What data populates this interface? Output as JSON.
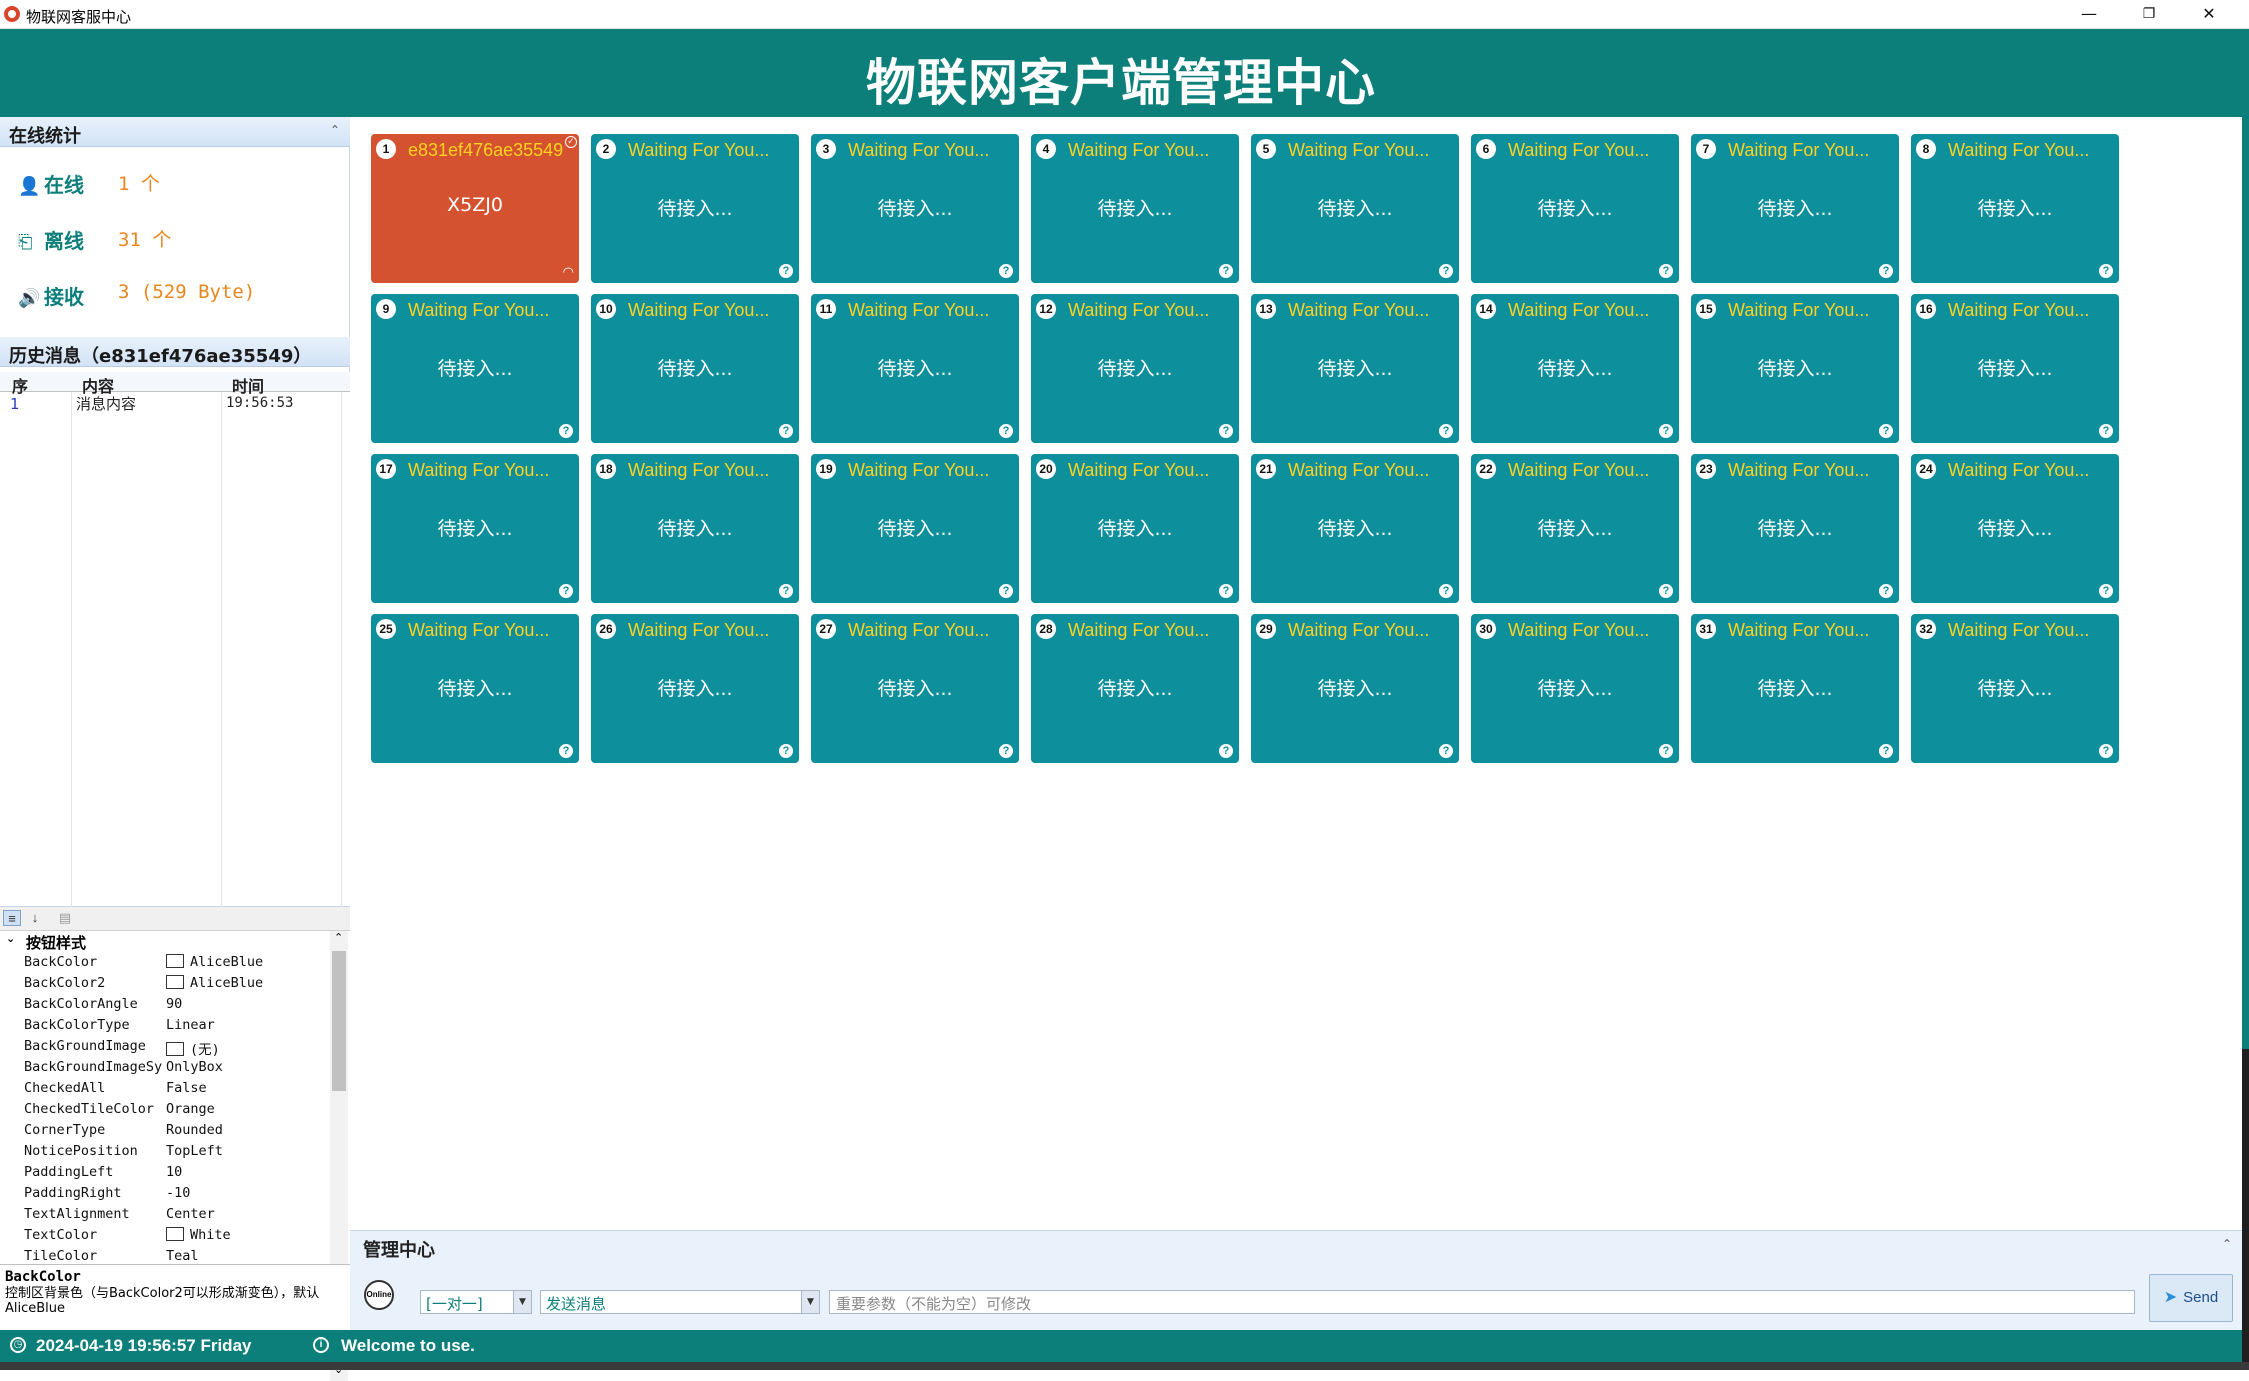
{
  "window": {
    "title": "物联网客服中心",
    "min": "—",
    "max": "❐",
    "close": "✕"
  },
  "header": {
    "title": "物联网客户端管理中心"
  },
  "stats": {
    "section_title": "在线统计",
    "online_label": "在线",
    "online_value": "1 个",
    "offline_label": "离线",
    "offline_value": "31 个",
    "receive_label": "接收",
    "receive_value": "3 (529 Byte)"
  },
  "history": {
    "section_title": "历史消息（e831ef476ae35549）",
    "columns": [
      "序",
      "内容",
      "时间"
    ],
    "rows": [
      {
        "seq": "1",
        "content": "消息内容",
        "time": "19:56:53"
      }
    ]
  },
  "property_grid": {
    "category": "按钮样式",
    "rows": [
      {
        "key": "BackColor",
        "value": "AliceBlue",
        "swatch": true
      },
      {
        "key": "BackColor2",
        "value": "AliceBlue",
        "swatch": true
      },
      {
        "key": "BackColorAngle",
        "value": "90"
      },
      {
        "key": "BackColorType",
        "value": "Linear"
      },
      {
        "key": "BackGroundImage",
        "value": "(无)",
        "swatch": true
      },
      {
        "key": "BackGroundImageSy",
        "value": "OnlyBox"
      },
      {
        "key": "CheckedAll",
        "value": "False"
      },
      {
        "key": "CheckedTileColor",
        "value": "Orange"
      },
      {
        "key": "CornerType",
        "value": "Rounded"
      },
      {
        "key": "NoticePosition",
        "value": "TopLeft"
      },
      {
        "key": "PaddingLeft",
        "value": "10"
      },
      {
        "key": "PaddingRight",
        "value": "-10"
      },
      {
        "key": "TextAlignment",
        "value": "Center"
      },
      {
        "key": "TextColor",
        "value": "White",
        "swatch": true
      },
      {
        "key": "TileColor",
        "value": "Teal"
      }
    ],
    "desc_title": "BackColor",
    "desc_text": "控制区背景色（与BackColor2可以形成渐变色），默认AliceBlue"
  },
  "tiles": [
    {
      "num": "1",
      "title": "e831ef476ae35549",
      "body": "X5ZJ0",
      "active": true
    },
    {
      "num": "2",
      "title": "Waiting For You...",
      "body": "待接入..."
    },
    {
      "num": "3",
      "title": "Waiting For You...",
      "body": "待接入..."
    },
    {
      "num": "4",
      "title": "Waiting For You...",
      "body": "待接入..."
    },
    {
      "num": "5",
      "title": "Waiting For You...",
      "body": "待接入..."
    },
    {
      "num": "6",
      "title": "Waiting For You...",
      "body": "待接入..."
    },
    {
      "num": "7",
      "title": "Waiting For You...",
      "body": "待接入..."
    },
    {
      "num": "8",
      "title": "Waiting For You...",
      "body": "待接入..."
    },
    {
      "num": "9",
      "title": "Waiting For You...",
      "body": "待接入..."
    },
    {
      "num": "10",
      "title": "Waiting For You...",
      "body": "待接入..."
    },
    {
      "num": "11",
      "title": "Waiting For You...",
      "body": "待接入..."
    },
    {
      "num": "12",
      "title": "Waiting For You...",
      "body": "待接入..."
    },
    {
      "num": "13",
      "title": "Waiting For You...",
      "body": "待接入..."
    },
    {
      "num": "14",
      "title": "Waiting For You...",
      "body": "待接入..."
    },
    {
      "num": "15",
      "title": "Waiting For You...",
      "body": "待接入..."
    },
    {
      "num": "16",
      "title": "Waiting For You...",
      "body": "待接入..."
    },
    {
      "num": "17",
      "title": "Waiting For You...",
      "body": "待接入..."
    },
    {
      "num": "18",
      "title": "Waiting For You...",
      "body": "待接入..."
    },
    {
      "num": "19",
      "title": "Waiting For You...",
      "body": "待接入..."
    },
    {
      "num": "20",
      "title": "Waiting For You...",
      "body": "待接入..."
    },
    {
      "num": "21",
      "title": "Waiting For You...",
      "body": "待接入..."
    },
    {
      "num": "22",
      "title": "Waiting For You...",
      "body": "待接入..."
    },
    {
      "num": "23",
      "title": "Waiting For You...",
      "body": "待接入..."
    },
    {
      "num": "24",
      "title": "Waiting For You...",
      "body": "待接入..."
    },
    {
      "num": "25",
      "title": "Waiting For You...",
      "body": "待接入..."
    },
    {
      "num": "26",
      "title": "Waiting For You...",
      "body": "待接入..."
    },
    {
      "num": "27",
      "title": "Waiting For You...",
      "body": "待接入..."
    },
    {
      "num": "28",
      "title": "Waiting For You...",
      "body": "待接入..."
    },
    {
      "num": "29",
      "title": "Waiting For You...",
      "body": "待接入..."
    },
    {
      "num": "30",
      "title": "Waiting For You...",
      "body": "待接入..."
    },
    {
      "num": "31",
      "title": "Waiting For You...",
      "body": "待接入..."
    },
    {
      "num": "32",
      "title": "Waiting For You...",
      "body": "待接入..."
    }
  ],
  "management": {
    "section_title": "管理中心",
    "globe_label": "Online",
    "mode_value": "[一对一]",
    "action_value": "发送消息",
    "param_placeholder": "重要参数（不能为空）可修改",
    "send_label": "Send"
  },
  "statusbar": {
    "time": "2024-04-19 19:56:57 Friday",
    "message": "Welcome to use."
  },
  "colors": {
    "teal": "#0c7f7a",
    "tile": "#0e8f9c",
    "active_tile": "#d4522f",
    "tile_title": "#ffd21f"
  }
}
